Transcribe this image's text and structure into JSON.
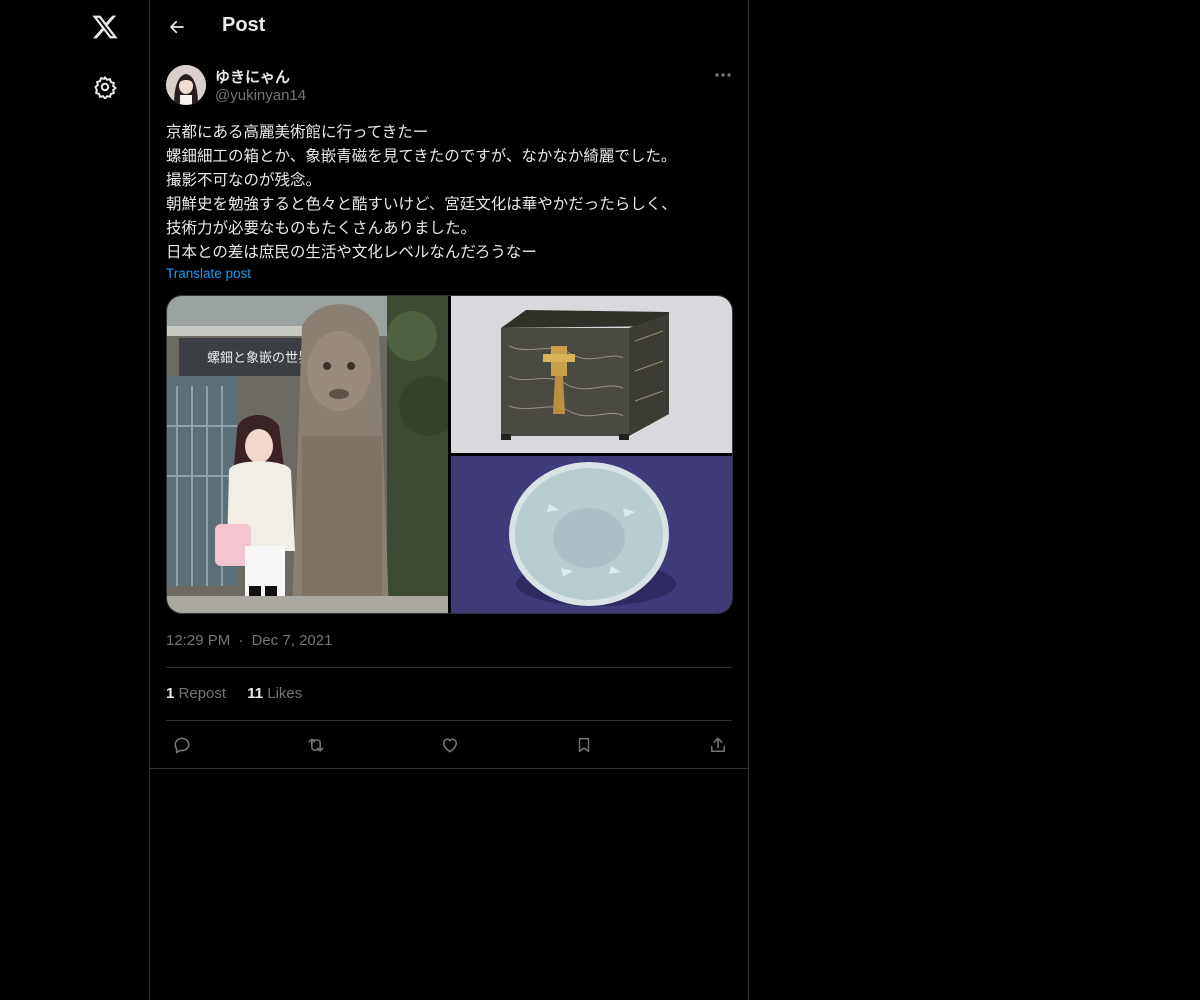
{
  "header": {
    "title": "Post"
  },
  "nav": {
    "icons": [
      "x-logo-icon",
      "gear-icon"
    ]
  },
  "post": {
    "author": {
      "display_name": "ゆきにゃん",
      "handle": "@yukinyan14"
    },
    "text_lines": [
      "京都にある高麗美術館に行ってきたー",
      "螺鈿細工の箱とか、象嵌青磁を見てきたのですが、なかなか綺麗でした。",
      "撮影不可なのが残念。",
      "朝鮮史を勉強すると色々と酷すいけど、宮廷文化は華やかだったらしく、",
      "技術力が必要なものもたくさんありました。",
      "日本との差は庶民の生活や文化レベルなんだろうなー"
    ],
    "translate_label": "Translate post",
    "media": {
      "banner_text": "螺鈿と象嵌の世界"
    },
    "time": "12:29 PM",
    "separator": "·",
    "date": "Dec 7, 2021",
    "stats": {
      "reposts_count": "1",
      "reposts_label": "Repost",
      "likes_count": "11",
      "likes_label": "Likes"
    },
    "actions": [
      "reply-icon",
      "repost-icon",
      "like-icon",
      "bookmark-icon",
      "share-icon"
    ]
  },
  "colors": {
    "background": "#000000",
    "text": "#e7e9ea",
    "secondary": "#71767b",
    "link": "#1d9bf0",
    "border": "#2f3336"
  }
}
